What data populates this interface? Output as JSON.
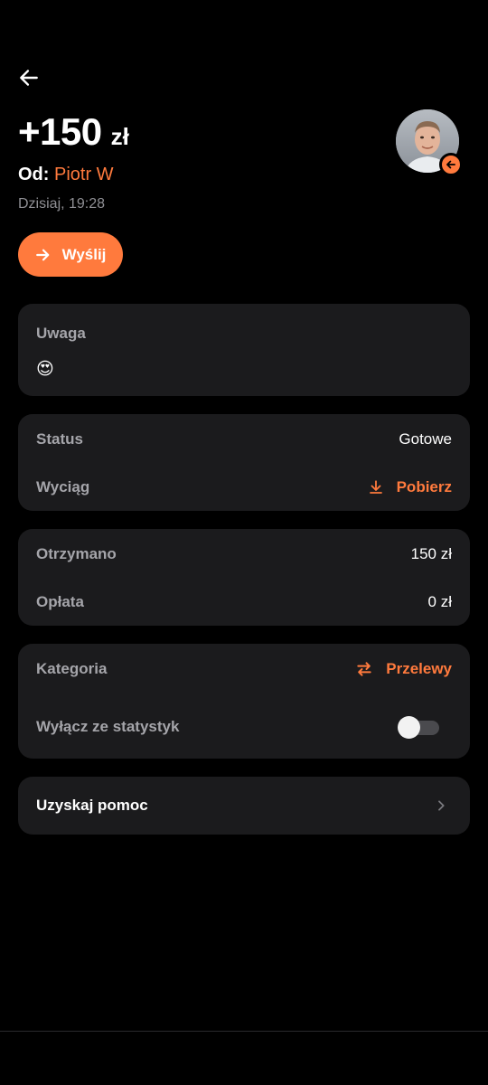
{
  "header": {
    "amount": "+150",
    "currency": "zł",
    "from_prefix": "Od:",
    "from_name": "Piotr W",
    "date": "Dzisiaj, 19:28"
  },
  "actions": {
    "send_label": "Wyślij"
  },
  "note_card": {
    "label": "Uwaga",
    "emoji": "😍"
  },
  "status_card": {
    "status_label": "Status",
    "status_value": "Gotowe",
    "statement_label": "Wyciąg",
    "statement_action": "Pobierz"
  },
  "amounts_card": {
    "received_label": "Otrzymano",
    "received_value": "150 zł",
    "fee_label": "Opłata",
    "fee_value": "0 zł"
  },
  "category_card": {
    "category_label": "Kategoria",
    "category_value": "Przelewy",
    "exclude_label": "Wyłącz ze statystyk",
    "exclude_enabled": false
  },
  "help_card": {
    "label": "Uzyskaj pomoc"
  },
  "colors": {
    "accent": "#ff7a3d",
    "background": "#000000",
    "card": "#1b1b1d"
  },
  "icons": {
    "back": "arrow-left-icon",
    "send": "arrow-right-icon",
    "download": "download-icon",
    "category": "swap-arrows-icon",
    "help_chevron": "chevron-right-icon",
    "avatar_badge": "incoming-arrow-icon"
  }
}
